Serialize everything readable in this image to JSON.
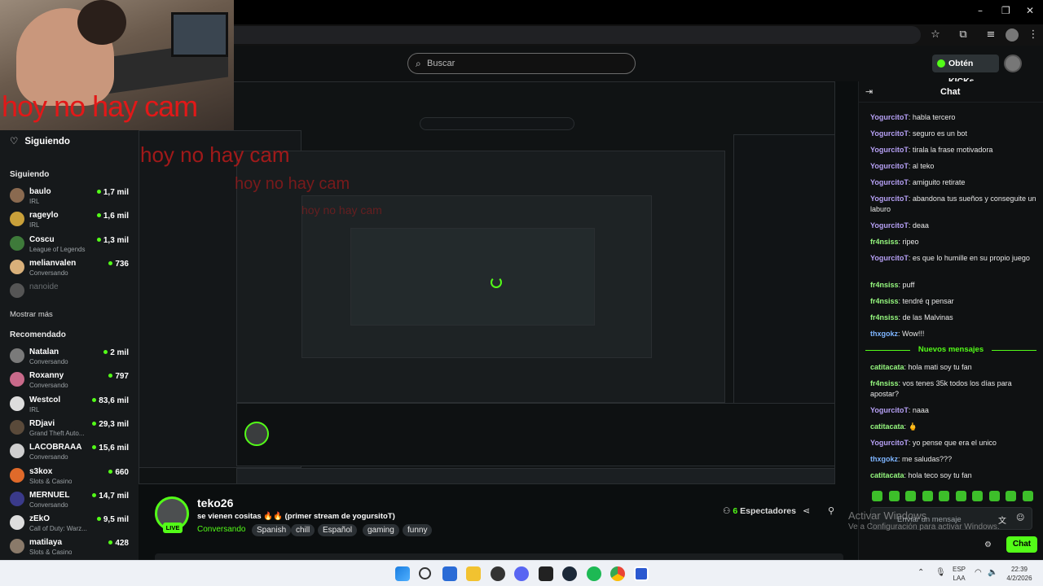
{
  "browser": {
    "star_icon": "star-icon",
    "extensions_icon": "puzzle-icon",
    "window_controls": {
      "minimize": "–",
      "maximize": "❐",
      "close": "✕"
    }
  },
  "topnav": {
    "search_placeholder": "Buscar",
    "kicks_label": "Obtén KICKs"
  },
  "cam_overlay": {
    "caption": "hoy no hay cam"
  },
  "sidebar": {
    "following_title": "Siguiendo",
    "following_header": "Siguiendo",
    "following": [
      {
        "name": "baulo",
        "category": "IRL",
        "viewers": "1,7 mil",
        "color": "#8a6a50"
      },
      {
        "name": "rageylo",
        "category": "IRL",
        "viewers": "1,6 mil",
        "color": "#c9a03a"
      },
      {
        "name": "Coscu",
        "category": "League of Legends",
        "viewers": "1,3 mil",
        "color": "#3e7a3a"
      },
      {
        "name": "melianvalen",
        "category": "Conversando",
        "viewers": "736",
        "color": "#d9b07a"
      },
      {
        "name": "nanoide",
        "category": "",
        "viewers": "",
        "color": "#555"
      }
    ],
    "show_more": "Mostrar más",
    "recommended_header": "Recomendado",
    "recommended": [
      {
        "name": "Natalan",
        "category": "Conversando",
        "viewers": "2 mil",
        "color": "#7a7a7a"
      },
      {
        "name": "Roxanny",
        "category": "Conversando",
        "viewers": "797",
        "color": "#c96a8a"
      },
      {
        "name": "Westcol",
        "category": "IRL",
        "viewers": "83,6 mil",
        "color": "#dddddd"
      },
      {
        "name": "RDjavi",
        "category": "Grand Theft Auto...",
        "viewers": "29,3 mil",
        "color": "#5a4a3a"
      },
      {
        "name": "LACOBRAAA",
        "category": "Conversando",
        "viewers": "15,6 mil",
        "color": "#cfcfcf"
      },
      {
        "name": "s3kox",
        "category": "Slots & Casino",
        "viewers": "660",
        "color": "#e06a2a"
      },
      {
        "name": "MERNUEL",
        "category": "Conversando",
        "viewers": "14,7 mil",
        "color": "#3a3a8a"
      },
      {
        "name": "zEkO",
        "category": "Call of Duty: Warz...",
        "viewers": "9,5 mil",
        "color": "#dddddd"
      },
      {
        "name": "matilaya",
        "category": "Slots & Casino",
        "viewers": "428",
        "color": "#8a7a6a"
      }
    ]
  },
  "stream": {
    "channel": "teko26",
    "live_badge": "LIVE",
    "title": "se vienen cositas 🔥🔥 (primer stream de yogursitoT)",
    "category": "Conversando",
    "tags": [
      "Spanish",
      "chill",
      "Español",
      "gaming",
      "funny"
    ],
    "viewers_count": "6",
    "viewers_label": "Espectadores"
  },
  "chat": {
    "title": "Chat",
    "new_messages_label": "Nuevos mensajes",
    "input_placeholder": "Enviar un mensaje",
    "send_label": "Chat",
    "messages": [
      {
        "user": "YogurcitoT",
        "text": "habla tercero",
        "color": "purple"
      },
      {
        "user": "YogurcitoT",
        "text": "seguro es un bot",
        "color": "purple"
      },
      {
        "user": "YogurcitoT",
        "text": "tirala la frase motivadora",
        "color": "purple"
      },
      {
        "user": "YogurcitoT",
        "text": "al teko",
        "color": "purple"
      },
      {
        "user": "YogurcitoT",
        "text": "amiguito retirate",
        "color": "purple"
      },
      {
        "user": "YogurcitoT",
        "text": "abandona tus sueños y conseguite un laburo",
        "color": "purple"
      },
      {
        "user": "YogurcitoT",
        "text": "deaa",
        "color": "purple"
      },
      {
        "user": "fr4nsiss",
        "text": "ripeo",
        "color": "green"
      },
      {
        "user": "YogurcitoT",
        "text": "es que lo humille en su propio juego",
        "color": "purple"
      },
      {
        "user": "fr4nsiss",
        "text": "puff",
        "color": "green"
      },
      {
        "user": "fr4nsiss",
        "text": "tendré q pensar",
        "color": "green"
      },
      {
        "user": "fr4nsiss",
        "text": "de las Malvinas",
        "color": "green"
      },
      {
        "user": "thxgokz",
        "text": "Wow!!!",
        "color": "blue"
      },
      {
        "user": "catitacata",
        "text": "hola mati soy tu fan",
        "color": "green"
      },
      {
        "user": "fr4nsiss",
        "text": "vos tenes 35k todos los días para apostar?",
        "color": "green"
      },
      {
        "user": "YogurcitoT",
        "text": "naaa",
        "color": "purple"
      },
      {
        "user": "catitacata",
        "text": "🖕",
        "color": "green"
      },
      {
        "user": "YogurcitoT",
        "text": "yo pense que era el unico",
        "color": "purple"
      },
      {
        "user": "thxgokz",
        "text": "me saludas???",
        "color": "blue"
      },
      {
        "user": "catitacata",
        "text": "hola teco soy tu fan",
        "color": "green"
      }
    ]
  },
  "windows_watermark": {
    "line1": "Activar Windows",
    "line2": "Ve a Configuración para activar Windows."
  },
  "taskbar": {
    "language": "ESP",
    "layout": "LAA",
    "time": "22:39",
    "date": "4/2/2026"
  }
}
